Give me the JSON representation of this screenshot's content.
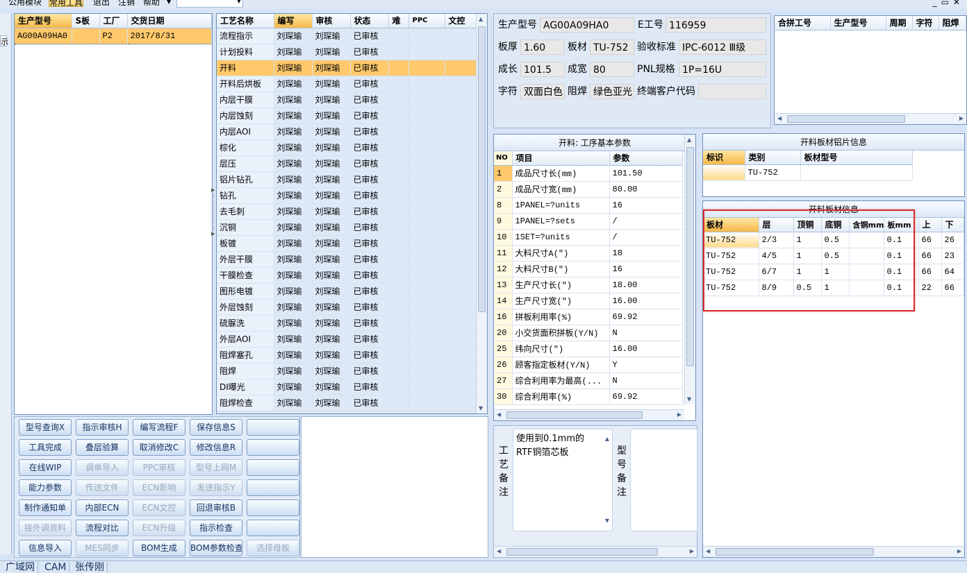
{
  "menu": {
    "items": [
      "公用模块",
      "常用工具",
      "退出",
      "注销",
      "帮助"
    ],
    "active_index": 1
  },
  "left_list": {
    "headers": [
      "生产型号",
      "S板",
      "工厂",
      "交货日期"
    ],
    "rows": [
      [
        "AG00A09HA0",
        "",
        "P2",
        "2017/8/31"
      ]
    ]
  },
  "process": {
    "headers": [
      "工艺名称",
      "编写",
      "审核",
      "状态",
      "难",
      "PPC",
      "文控"
    ],
    "selected_index": 2,
    "rows": [
      [
        "流程指示",
        "刘琛瑜",
        "刘琛瑜",
        "已审核"
      ],
      [
        "计划投料",
        "刘琛瑜",
        "刘琛瑜",
        "已审核"
      ],
      [
        "开料",
        "刘琛瑜",
        "刘琛瑜",
        "已审核"
      ],
      [
        "开料后烘板",
        "刘琛瑜",
        "刘琛瑜",
        "已审核"
      ],
      [
        "内层干膜",
        "刘琛瑜",
        "刘琛瑜",
        "已审核"
      ],
      [
        "内层蚀刻",
        "刘琛瑜",
        "刘琛瑜",
        "已审核"
      ],
      [
        "内层AOI",
        "刘琛瑜",
        "刘琛瑜",
        "已审核"
      ],
      [
        "棕化",
        "刘琛瑜",
        "刘琛瑜",
        "已审核"
      ],
      [
        "层压",
        "刘琛瑜",
        "刘琛瑜",
        "已审核"
      ],
      [
        "铝片钻孔",
        "刘琛瑜",
        "刘琛瑜",
        "已审核"
      ],
      [
        "钻孔",
        "刘琛瑜",
        "刘琛瑜",
        "已审核"
      ],
      [
        "去毛刺",
        "刘琛瑜",
        "刘琛瑜",
        "已审核"
      ],
      [
        "沉铜",
        "刘琛瑜",
        "刘琛瑜",
        "已审核"
      ],
      [
        "板镀",
        "刘琛瑜",
        "刘琛瑜",
        "已审核"
      ],
      [
        "外层干膜",
        "刘琛瑜",
        "刘琛瑜",
        "已审核"
      ],
      [
        "干膜检查",
        "刘琛瑜",
        "刘琛瑜",
        "已审核"
      ],
      [
        "图形电镀",
        "刘琛瑜",
        "刘琛瑜",
        "已审核"
      ],
      [
        "外层蚀刻",
        "刘琛瑜",
        "刘琛瑜",
        "已审核"
      ],
      [
        "硫脲洗",
        "刘琛瑜",
        "刘琛瑜",
        "已审核"
      ],
      [
        "外层AOI",
        "刘琛瑜",
        "刘琛瑜",
        "已审核"
      ],
      [
        "阻焊塞孔",
        "刘琛瑜",
        "刘琛瑜",
        "已审核"
      ],
      [
        "阻焊",
        "刘琛瑜",
        "刘琛瑜",
        "已审核"
      ],
      [
        "DI曝光",
        "刘琛瑜",
        "刘琛瑜",
        "已审核"
      ],
      [
        "阻焊检查",
        "刘琛瑜",
        "刘琛瑜",
        "已审核"
      ]
    ]
  },
  "buttons": [
    [
      "型号查询X",
      "指示审核H",
      "编写流程F",
      "保存信息S",
      ""
    ],
    [
      "工具完成",
      "叠层验算",
      "取消修改C",
      "修改信息R",
      ""
    ],
    [
      "在线WIP",
      "调单导入",
      "PPC审核",
      "型号上网M",
      ""
    ],
    [
      "能力参数",
      "传送文件",
      "ECN影响",
      "发送指示Y",
      ""
    ],
    [
      "制作通知单",
      "内部ECN",
      "ECN文控",
      "回退审核B",
      ""
    ],
    [
      "接外调资料",
      "流程对比",
      "ECN升级",
      "指示检查",
      ""
    ],
    [
      "信息导入",
      "MES同步",
      "BOM生成",
      "BOM参数检查",
      "选择母板"
    ]
  ],
  "disabled_buttons": [
    "调单导入",
    "PPC审核",
    "型号上网M",
    "传送文件",
    "ECN影响",
    "发送指示Y",
    "ECN文控",
    "接外调资料",
    "ECN升级",
    "MES同步",
    "选择母板"
  ],
  "info": {
    "model_label": "生产型号",
    "model": "AG00A09HA0",
    "e_label": "E工号",
    "e_no": "116959",
    "thick_label": "板厚",
    "thick": "1.60",
    "material_label": "板材",
    "material": "TU-752",
    "standard_label": "验收标准",
    "standard": "IPC-6012 Ⅲ级",
    "len_label": "成长",
    "len": "101.5",
    "width_label": "成宽",
    "width": "80",
    "pnl_label": "PNL规格",
    "pnl": "1P=16U",
    "char_label": "字符",
    "char": "双面白色",
    "mask_label": "阻焊",
    "mask": "绿色亚光",
    "customer_label": "终端客户代码",
    "customer": ""
  },
  "merge_list": {
    "headers": [
      "合拼工号",
      "生产型号",
      "周期",
      "字符",
      "阻焊"
    ]
  },
  "params": {
    "title": "开料: 工序基本参数",
    "headers": [
      "NO",
      "项目",
      "参数"
    ],
    "selected_index": 0,
    "rows": [
      [
        "1",
        "成品尺寸长(mm)",
        "101.50"
      ],
      [
        "2",
        "成品尺寸宽(mm)",
        "80.00"
      ],
      [
        "8",
        "1PANEL=?units",
        "16"
      ],
      [
        "9",
        "1PANEL=?sets",
        "/"
      ],
      [
        "10",
        "1SET=?units",
        "/"
      ],
      [
        "11",
        "大料尺寸A(\")",
        "18"
      ],
      [
        "12",
        "大料尺寸B(\")",
        "16"
      ],
      [
        "13",
        "生产尺寸长(\")",
        "18.00"
      ],
      [
        "14",
        "生产尺寸宽(\")",
        "16.00"
      ],
      [
        "16",
        "拼板利用率(%)",
        "69.92"
      ],
      [
        "20",
        "小交货面积拼板(Y/N)",
        "N"
      ],
      [
        "25",
        "纬向尺寸(\")",
        "16.00"
      ],
      [
        "26",
        "顾客指定板材(Y/N)",
        "Y"
      ],
      [
        "27",
        "综合利用率为最高(...",
        "N"
      ],
      [
        "30",
        "综合利用率(%)",
        "69.92"
      ]
    ]
  },
  "notes": {
    "process_label": "工艺备注",
    "process_note": "使用到0.1mm的RTF铜箔芯板",
    "model_label": "型号备注",
    "model_note": ""
  },
  "foil": {
    "title": "开料板材铝片信息",
    "headers": [
      "标识",
      "类别",
      "板材型号"
    ],
    "rows": [
      [
        "",
        "TU-752",
        ""
      ]
    ]
  },
  "board": {
    "title": "开料板材信息",
    "headers": [
      "板材",
      "层",
      "顶铜",
      "底铜",
      "含铜mm",
      "板mm",
      "上",
      "下"
    ],
    "selected_index": 0,
    "rows": [
      [
        "TU-752",
        "2/3",
        "1",
        "0.5",
        "",
        "0.1",
        "66",
        "26"
      ],
      [
        "TU-752",
        "4/5",
        "1",
        "0.5",
        "",
        "0.1",
        "66",
        "23"
      ],
      [
        "TU-752",
        "6/7",
        "1",
        "1",
        "",
        "0.1",
        "66",
        "64"
      ],
      [
        "TU-752",
        "8/9",
        "0.5",
        "1",
        "",
        "0.1",
        "22",
        "66"
      ]
    ]
  },
  "status": [
    "广域网",
    "CAM",
    "张传刚"
  ],
  "icons": {
    "left_gutter": "show-icon",
    "window": "minimize-restore-close-icons"
  },
  "colors": {
    "accent": "#ffc96b",
    "highlight_box": "#d92b2b",
    "chrome": "#d6e4f5"
  }
}
